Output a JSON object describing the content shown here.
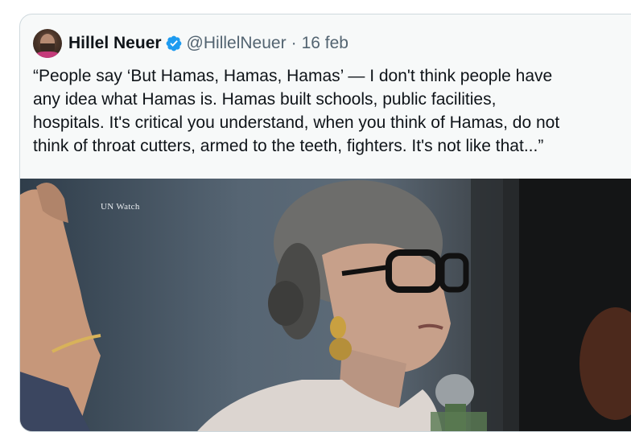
{
  "quoted_tweet": {
    "author_name": "Hillel Neuer",
    "handle": "@HillelNeuer",
    "separator": "·",
    "date": "16 feb",
    "text_lines": [
      "“People say ‘But Hamas, Hamas, Hamas’ — I don't think people have",
      "any idea what Hamas is. Hamas built schools, public facilities,",
      "hospitals. It's critical you understand, when you think of Hamas, do not",
      "think of throat cutters, armed to the teeth, fighters. It's not like that...”"
    ],
    "media": {
      "watermark": "UN Watch"
    },
    "avatar_icon": "user-avatar",
    "verified_icon": "verified-badge-icon"
  },
  "colors": {
    "verified_blue": "#1d9bf0",
    "text_primary": "#0f1419",
    "text_secondary": "#536471",
    "card_bg": "#f7f9f9",
    "card_border": "#cfd9de"
  }
}
